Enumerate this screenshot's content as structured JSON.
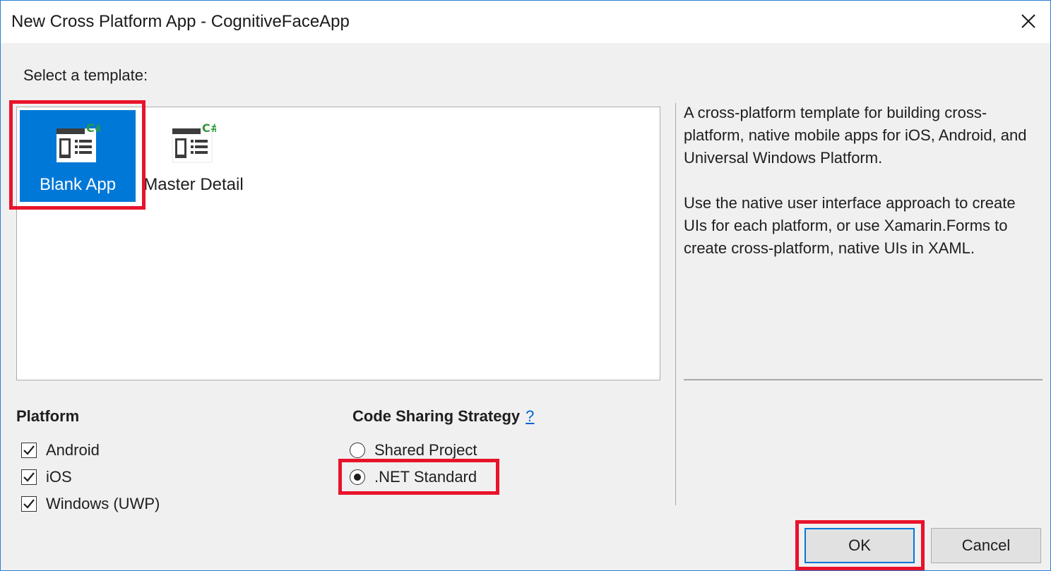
{
  "window": {
    "title": "New Cross Platform App - CognitiveFaceApp"
  },
  "template_section": {
    "label": "Select a template:",
    "templates": [
      {
        "label": "Blank App",
        "icon": "blank-app-template-icon",
        "selected": true
      },
      {
        "label": "Master Detail",
        "icon": "master-detail-template-icon",
        "selected": false
      }
    ],
    "description": [
      "A cross-platform template for building cross-platform, native mobile apps for iOS, Android, and Universal Windows Platform.",
      "Use the native user interface approach to create UIs for each platform, or use Xamarin.Forms to create cross-platform, native UIs in XAML."
    ]
  },
  "platform": {
    "title": "Platform",
    "options": [
      {
        "label": "Android",
        "checked": true
      },
      {
        "label": "iOS",
        "checked": true
      },
      {
        "label": "Windows (UWP)",
        "checked": true
      }
    ]
  },
  "code_sharing": {
    "title": "Code Sharing Strategy",
    "help_link": "?",
    "options": [
      {
        "label": "Shared Project",
        "selected": false
      },
      {
        "label": ".NET Standard",
        "selected": true
      }
    ]
  },
  "buttons": {
    "ok": "OK",
    "cancel": "Cancel"
  },
  "colors": {
    "accent": "#0078d7",
    "highlight": "#e8132b",
    "csharp_badge": "#2e9a3e"
  }
}
